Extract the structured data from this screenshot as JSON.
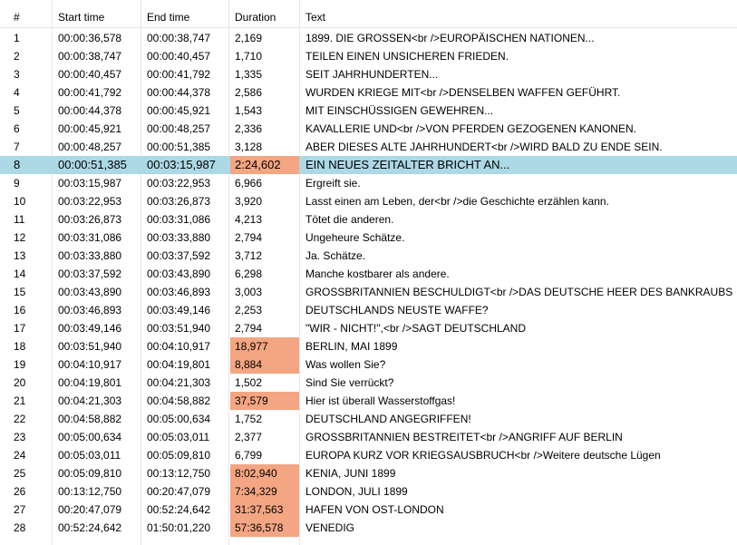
{
  "columns": {
    "num": "#",
    "start": "Start time",
    "end": "End time",
    "duration": "Duration",
    "text": "Text"
  },
  "rows": [
    {
      "num": "1",
      "start": "00:00:36,578",
      "end": "00:00:38,747",
      "duration": "2,169",
      "text": "1899. DIE GROSSEN<br />EUROPÄISCHEN NATIONEN...",
      "warn": false
    },
    {
      "num": "2",
      "start": "00:00:38,747",
      "end": "00:00:40,457",
      "duration": "1,710",
      "text": "TEILEN EINEN UNSICHEREN FRIEDEN.",
      "warn": false
    },
    {
      "num": "3",
      "start": "00:00:40,457",
      "end": "00:00:41,792",
      "duration": "1,335",
      "text": "SEIT JAHRHUNDERTEN...",
      "warn": false
    },
    {
      "num": "4",
      "start": "00:00:41,792",
      "end": "00:00:44,378",
      "duration": "2,586",
      "text": "WURDEN KRIEGE MIT<br />DENSELBEN WAFFEN GEFÜHRT.",
      "warn": false
    },
    {
      "num": "5",
      "start": "00:00:44,378",
      "end": "00:00:45,921",
      "duration": "1,543",
      "text": "MIT EINSCHÜSSIGEN GEWEHREN...",
      "warn": false
    },
    {
      "num": "6",
      "start": "00:00:45,921",
      "end": "00:00:48,257",
      "duration": "2,336",
      "text": "KAVALLERIE UND<br />VON PFERDEN GEZOGENEN KANONEN.",
      "warn": false
    },
    {
      "num": "7",
      "start": "00:00:48,257",
      "end": "00:00:51,385",
      "duration": "3,128",
      "text": "ABER DIESES ALTE JAHRHUNDERT<br />WIRD BALD ZU ENDE SEIN.",
      "warn": false
    },
    {
      "num": "8",
      "start": "00:00:51,385",
      "end": "00:03:15,987",
      "duration": "2:24,602",
      "text": "EIN NEUES ZEITALTER BRICHT AN...",
      "warn": true,
      "selected": true
    },
    {
      "num": "9",
      "start": "00:03:15,987",
      "end": "00:03:22,953",
      "duration": "6,966",
      "text": "Ergreift sie.",
      "warn": false
    },
    {
      "num": "10",
      "start": "00:03:22,953",
      "end": "00:03:26,873",
      "duration": "3,920",
      "text": "Lasst einen am Leben, der<br />die Geschichte erzählen kann.",
      "warn": false
    },
    {
      "num": "11",
      "start": "00:03:26,873",
      "end": "00:03:31,086",
      "duration": "4,213",
      "text": "Tötet die anderen.",
      "warn": false
    },
    {
      "num": "12",
      "start": "00:03:31,086",
      "end": "00:03:33,880",
      "duration": "2,794",
      "text": "Ungeheure Schätze.",
      "warn": false
    },
    {
      "num": "13",
      "start": "00:03:33,880",
      "end": "00:03:37,592",
      "duration": "3,712",
      "text": "Ja. Schätze.",
      "warn": false
    },
    {
      "num": "14",
      "start": "00:03:37,592",
      "end": "00:03:43,890",
      "duration": "6,298",
      "text": "Manche kostbarer als andere.",
      "warn": false
    },
    {
      "num": "15",
      "start": "00:03:43,890",
      "end": "00:03:46,893",
      "duration": "3,003",
      "text": "GROSSBRITANNIEN BESCHULDIGT<br />DAS DEUTSCHE HEER DES BANKRAUBS",
      "warn": false
    },
    {
      "num": "16",
      "start": "00:03:46,893",
      "end": "00:03:49,146",
      "duration": "2,253",
      "text": "DEUTSCHLANDS NEUSTE WAFFE?",
      "warn": false
    },
    {
      "num": "17",
      "start": "00:03:49,146",
      "end": "00:03:51,940",
      "duration": "2,794",
      "text": "\"WIR - NICHT!\",<br />SAGT DEUTSCHLAND",
      "warn": false
    },
    {
      "num": "18",
      "start": "00:03:51,940",
      "end": "00:04:10,917",
      "duration": "18,977",
      "text": "BERLIN, MAI 1899",
      "warn": true
    },
    {
      "num": "19",
      "start": "00:04:10,917",
      "end": "00:04:19,801",
      "duration": "8,884",
      "text": "Was wollen Sie?",
      "warn": true
    },
    {
      "num": "20",
      "start": "00:04:19,801",
      "end": "00:04:21,303",
      "duration": "1,502",
      "text": "Sind Sie verrückt?",
      "warn": false
    },
    {
      "num": "21",
      "start": "00:04:21,303",
      "end": "00:04:58,882",
      "duration": "37,579",
      "text": "Hier ist überall Wasserstoffgas!",
      "warn": true
    },
    {
      "num": "22",
      "start": "00:04:58,882",
      "end": "00:05:00,634",
      "duration": "1,752",
      "text": "DEUTSCHLAND ANGEGRIFFEN!",
      "warn": false
    },
    {
      "num": "23",
      "start": "00:05:00,634",
      "end": "00:05:03,011",
      "duration": "2,377",
      "text": "GROSSBRITANNIEN BESTREITET<br />ANGRIFF AUF BERLIN",
      "warn": false
    },
    {
      "num": "24",
      "start": "00:05:03,011",
      "end": "00:05:09,810",
      "duration": "6,799",
      "text": "EUROPA KURZ VOR KRIEGSAUSBRUCH<br />Weitere deutsche Lügen",
      "warn": false
    },
    {
      "num": "25",
      "start": "00:05:09,810",
      "end": "00:13:12,750",
      "duration": "8:02,940",
      "text": "KENIA, JUNI 1899",
      "warn": true
    },
    {
      "num": "26",
      "start": "00:13:12,750",
      "end": "00:20:47,079",
      "duration": "7:34,329",
      "text": "LONDON, JULI 1899",
      "warn": true
    },
    {
      "num": "27",
      "start": "00:20:47,079",
      "end": "00:52:24,642",
      "duration": "31:37,563",
      "text": "HAFEN VON OST-LONDON",
      "warn": true
    },
    {
      "num": "28",
      "start": "00:52:24,642",
      "end": "01:50:01,220",
      "duration": "57:36,578",
      "text": "VENEDIG",
      "warn": true
    }
  ],
  "colors": {
    "selected_row": "#add8e6",
    "duration_warning": "#f4a582",
    "grid_line": "#e8e8e8"
  }
}
